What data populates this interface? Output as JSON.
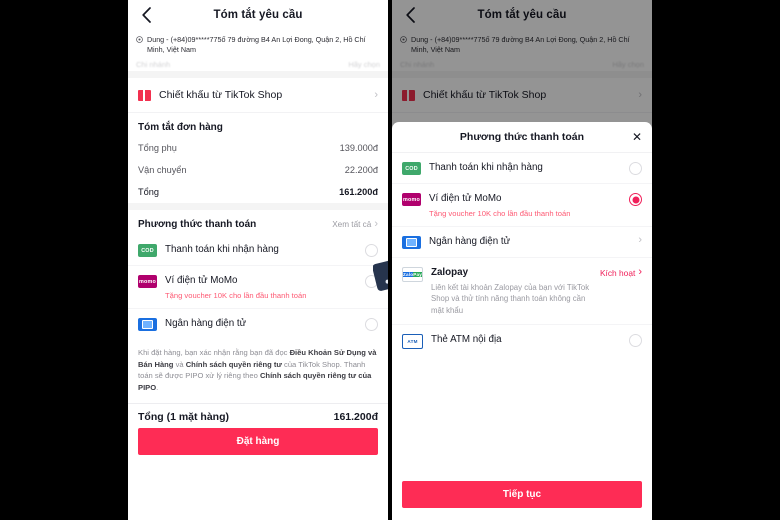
{
  "left_screen": {
    "topbar": {
      "back_icon": "chevron-left-icon",
      "title": "Tóm tắt yêu cầu"
    },
    "address": {
      "pin_icon": "location-pin-icon",
      "text": "Dung - (+84)09*****775ố 79 đường B4 An Lợi Đong, Quận 2, Hồ Chí Minh, Việt Nam"
    },
    "faded_row": {
      "left": "Chi nhánh",
      "right": "Hãy chọn"
    },
    "discount": {
      "icon": "coupon-icon",
      "label": "Chiết khấu từ TikTok Shop",
      "chevron": "chevron-right-icon"
    },
    "order_summary": {
      "title": "Tóm tắt đơn hàng",
      "rows": [
        {
          "key": "Tổng phụ",
          "value": "139.000đ"
        },
        {
          "key": "Vận chuyển",
          "value": "22.200đ"
        },
        {
          "key": "Tổng",
          "value": "161.200đ"
        }
      ]
    },
    "payment": {
      "title": "Phương thức thanh toán",
      "more_label": "Xem tất cả",
      "more_chevron": "chevron-right-icon",
      "methods": [
        {
          "icon": "cod-icon",
          "icon_text": "COD",
          "label": "Thanh toán khi nhận hàng",
          "selected": false
        },
        {
          "icon": "momo-icon",
          "icon_text": "momo",
          "label": "Ví điện tử MoMo",
          "sub": "Tặng voucher 10K cho lần đầu thanh toán",
          "selected": false
        },
        {
          "icon": "bank-icon",
          "icon_text": "",
          "label": "Ngân hàng điện tử",
          "selected": false
        }
      ]
    },
    "terms": {
      "p1": "Khi đặt hàng, bạn xác nhận rằng bạn đã đọc ",
      "b1": "Điều Khoản Sử Dụng và Bán Hàng",
      "p2": " và ",
      "b2": "Chính sách quyền riêng tư",
      "p3": " của TikTok Shop. Thanh toán sẽ được PIPO xử lý riêng theo ",
      "b3": "Chính sách quyền riêng tư của PIPO",
      "p4": "."
    },
    "bottom": {
      "total_label": "Tổng (1 mặt hàng)",
      "total_value": "161.200đ",
      "cta_label": "Đặt hàng"
    }
  },
  "right_screen": {
    "topbar": {
      "back_icon": "chevron-left-icon",
      "title": "Tóm tắt yêu cầu"
    },
    "address": {
      "pin_icon": "location-pin-icon",
      "text": "Dung - (+84)09*****775ố 79 đường B4 An Lợi Đong, Quận 2, Hồ Chí Minh, Việt Nam"
    },
    "faded_row": {
      "left": "Chi nhánh",
      "right": "Hãy chọn"
    },
    "discount": {
      "icon": "coupon-icon",
      "label": "Chiết khấu từ TikTok Shop",
      "chevron": "chevron-right-icon"
    },
    "sheet": {
      "title": "Phương thức thanh toán",
      "close_icon": "close-icon",
      "methods": [
        {
          "icon": "cod-icon",
          "icon_text": "COD",
          "label": "Thanh toán khi nhận hàng",
          "selected": false
        },
        {
          "icon": "momo-icon",
          "icon_text": "momo",
          "label": "Ví điện tử MoMo",
          "sub": "Tặng voucher 10K cho lần đầu thanh toán",
          "selected": true
        },
        {
          "icon": "bank-icon",
          "icon_text": "",
          "label": "Ngân hàng điện tử",
          "chevron": "chevron-right-icon"
        },
        {
          "icon": "zalopay-icon",
          "icon_text_1": "Zalo",
          "icon_text_2": "Pay",
          "label": "Zalopay",
          "action_label": "Kích hoạt",
          "action_chevron": "chevron-right-icon",
          "desc": "Liên kết tài khoản Zalopay của bạn với TikTok Shop và thử tính năng thanh toán không cần mật khẩu"
        },
        {
          "icon": "atm-icon",
          "icon_text": "ATM",
          "label": "Thẻ ATM nội địa",
          "selected": false
        }
      ],
      "cta_label": "Tiếp tục"
    }
  },
  "cursors": {
    "left_hand": "pointing-hand-cursor",
    "right_hand": "pointing-hand-cursor"
  },
  "colors": {
    "brand_pink": "#fe2c55",
    "radio_selected": "#f0205a",
    "cod_green": "#3fa86b",
    "momo_magenta": "#b0006d",
    "bank_blue": "#1a6fe0",
    "page_bg": "#000000"
  }
}
